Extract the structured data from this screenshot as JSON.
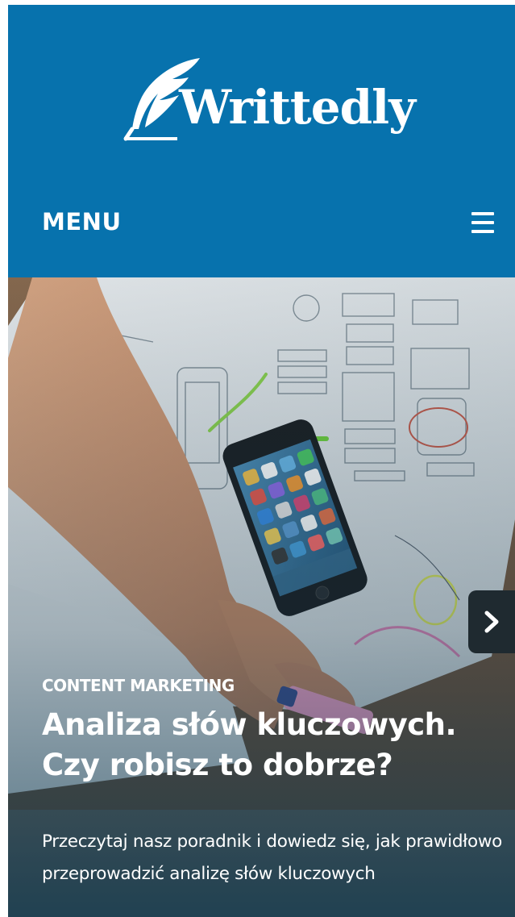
{
  "header": {
    "logo_text": "Writtedly",
    "menu_label": "MENU"
  },
  "slide": {
    "category": "CONTENT MARKETING",
    "title": "Analiza słów kluczowych. Czy robisz to dobrze?",
    "excerpt": "Przeczytaj nasz poradnik i dowiedz się, jak prawidłowo przeprowadzić analizę słów kluczowych"
  },
  "icons": {
    "logo": "feather-quill-icon",
    "menu": "hamburger-icon",
    "next": "chevron-right-icon"
  },
  "colors": {
    "brand_blue": "#0772ad",
    "arrow_bg": "#1f2a30",
    "text": "#ffffff"
  }
}
